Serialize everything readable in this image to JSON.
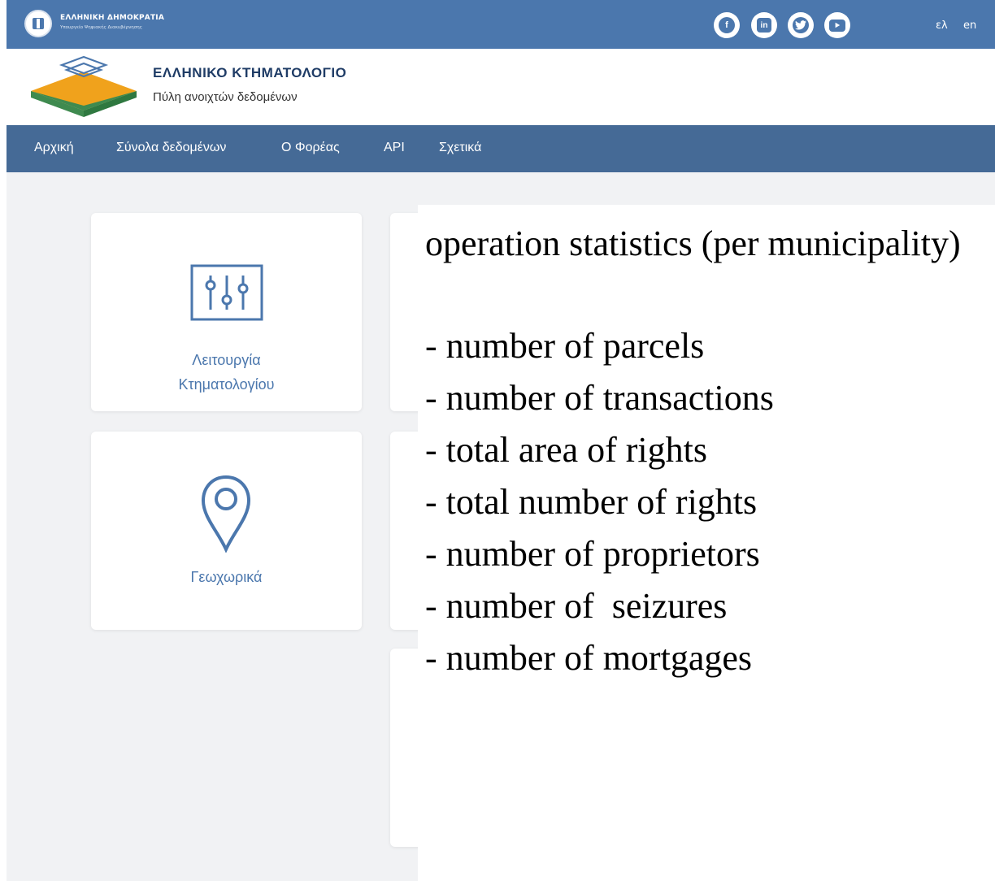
{
  "gov_bar": {
    "title": "ΕΛΛΗΝΙΚΗ ΔΗΜΟΚΡΑΤΙΑ",
    "subtitle": "Υπουργείο Ψηφιακής Διακυβέρνησης",
    "social_icons": [
      "facebook-icon",
      "linkedin-icon",
      "twitter-icon",
      "youtube-icon"
    ],
    "languages": [
      "ελ",
      "en"
    ]
  },
  "brand": {
    "title": "ΕΛΛΗΝΙΚΟ ΚΤΗΜΑΤΟΛΟΓΙΟ",
    "subtitle": "Πύλη ανοιχτών δεδομένων"
  },
  "nav": {
    "items": [
      "Αρχική",
      "Σύνολα δεδομένων",
      "Ο Φορέας",
      "API",
      "Σχετικά"
    ]
  },
  "cards": [
    {
      "icon": "sliders-icon",
      "label_line1": "Λειτουργία",
      "label_line2": "Κτηματολογίου"
    },
    {
      "icon": "map-pin-icon",
      "label": "Γεωχωρικά"
    }
  ],
  "overlay": {
    "heading": "operation statistics (per municipality)",
    "items": [
      "- number of parcels",
      "- number of transactions",
      "- total area of rights",
      "- total number of rights",
      "- number of proprietors",
      "- number of  seizures",
      "- number of mortgages"
    ]
  },
  "colors": {
    "gov_bar": "#4b77ad",
    "nav": "#456a96",
    "brand_title": "#1f3c66",
    "accent": "#4b77ad",
    "logo_orange": "#f0a21c",
    "logo_green": "#3f8a4f"
  }
}
